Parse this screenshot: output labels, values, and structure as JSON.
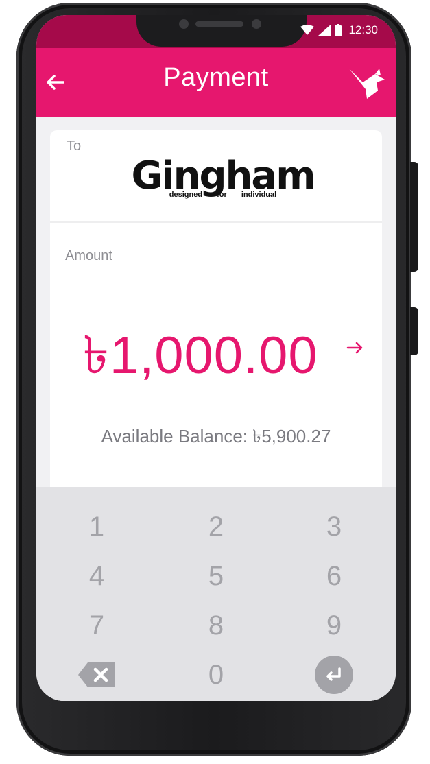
{
  "status_bar": {
    "time": "12:30",
    "icons": [
      "wifi-icon",
      "cellular-signal-icon",
      "battery-icon"
    ]
  },
  "app_bar": {
    "title": "Payment",
    "back_icon": "arrow-left-icon",
    "brand_icon": "bird-logo-icon"
  },
  "recipient": {
    "label": "To",
    "merchant_name": "Gingham",
    "merchant_tagline": "designed for individual"
  },
  "amount": {
    "label": "Amount",
    "value": "৳1,000.00",
    "go_icon": "arrow-right-icon"
  },
  "balance": {
    "text": "Available Balance: ৳5,900.27"
  },
  "keypad": {
    "keys": [
      "1",
      "2",
      "3",
      "4",
      "5",
      "6",
      "7",
      "8",
      "9"
    ],
    "zero": "0",
    "backspace_icon": "backspace-icon",
    "enter_icon": "enter-icon"
  },
  "colors": {
    "accent": "#e6176e",
    "status_bar": "#a50a4a",
    "keypad_bg": "#e2e2e5",
    "key_text": "#a3a3a8"
  }
}
